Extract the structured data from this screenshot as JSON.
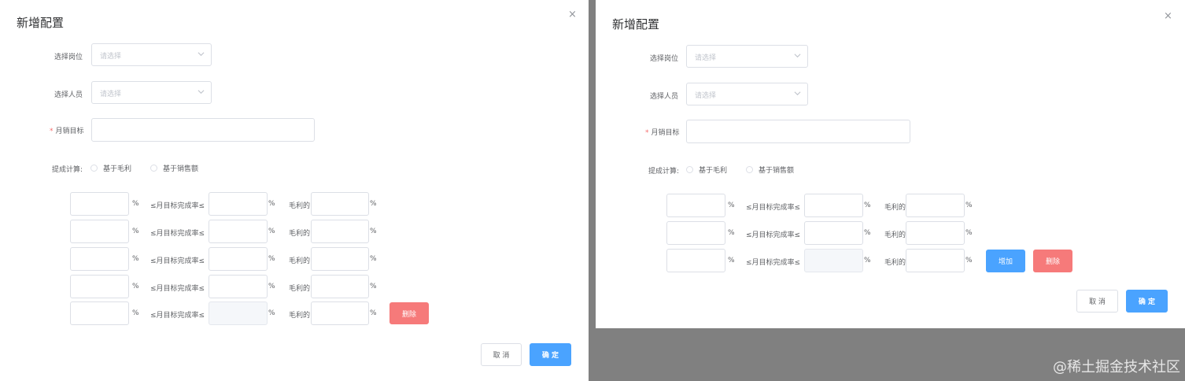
{
  "dialog1": {
    "title": "新增配置",
    "close": "×",
    "fields": {
      "position_label": "选择岗位",
      "position_placeholder": "请选择",
      "person_label": "选择人员",
      "person_placeholder": "请选择",
      "required_mark": "*",
      "target_label": "月销目标",
      "target_value": ""
    },
    "commission": {
      "label": "提成计算:",
      "option1": "基于毛利",
      "option2": "基于销售额"
    },
    "tier_text": {
      "percent": "%",
      "completion": "≤月目标完成率≤",
      "profit": "毛利的"
    },
    "delete_label": "删除",
    "footer": {
      "cancel": "取 消",
      "confirm": "确 定"
    }
  },
  "dialog2": {
    "title": "新增配置",
    "close": "×",
    "fields": {
      "position_label": "选择岗位",
      "position_placeholder": "请选择",
      "person_label": "选择人员",
      "person_placeholder": "请选择",
      "required_mark": "*",
      "target_label": "月销目标",
      "target_value": ""
    },
    "commission": {
      "label": "提成计算:",
      "option1": "基于毛利",
      "option2": "基于销售额"
    },
    "tier_text": {
      "percent": "%",
      "completion": "≤月目标完成率≤",
      "profit": "毛利的"
    },
    "add_label": "增加",
    "delete_label": "删除",
    "footer": {
      "cancel": "取 消",
      "confirm": "确 定"
    }
  },
  "watermark": "@稀土掘金技术社区",
  "icons": {
    "close": "close-icon",
    "dropdown": "chevron-down-icon"
  },
  "colors": {
    "primary": "#4aa3ff",
    "danger": "#f67a7a",
    "overlay": "#808080"
  }
}
